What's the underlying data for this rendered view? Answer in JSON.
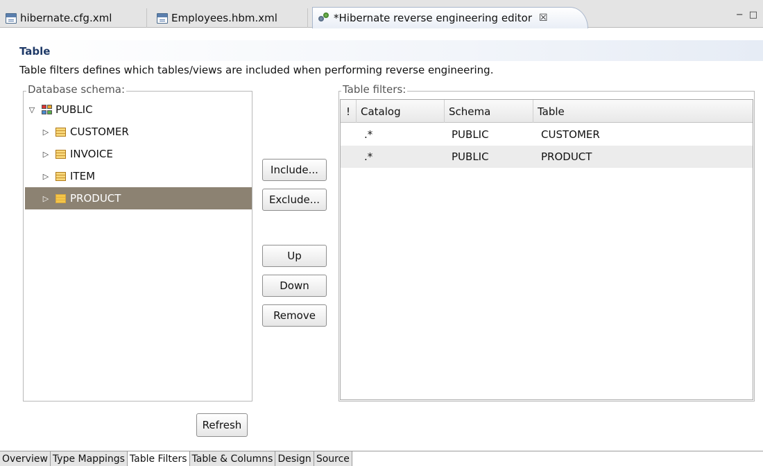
{
  "editor_tabs": [
    {
      "label": "hibernate.cfg.xml",
      "icon": "xml-file-icon"
    },
    {
      "label": "Employees.hbm.xml",
      "icon": "xml-file-icon"
    },
    {
      "label": "*Hibernate reverse engineering editor",
      "icon": "hibernate-icon",
      "close": "☒"
    }
  ],
  "window_controls": "− □",
  "section": {
    "title": "Table",
    "description": "Table filters defines which tables/views are included when performing reverse engineering."
  },
  "schema": {
    "group_label": "Database schema:",
    "root": {
      "label": "PUBLIC",
      "expanded": true
    },
    "tables": [
      {
        "label": "CUSTOMER",
        "selected": false
      },
      {
        "label": "INVOICE",
        "selected": false
      },
      {
        "label": "ITEM",
        "selected": false
      },
      {
        "label": "PRODUCT",
        "selected": true
      }
    ]
  },
  "buttons": {
    "include": "Include...",
    "exclude": "Exclude...",
    "up": "Up",
    "down": "Down",
    "remove": "Remove",
    "refresh": "Refresh"
  },
  "filters": {
    "group_label": "Table filters:",
    "columns": [
      "!",
      "Catalog",
      "Schema",
      "Table"
    ],
    "rows": [
      {
        "exclude": "",
        "catalog": ".*",
        "schema": "PUBLIC",
        "table": "CUSTOMER"
      },
      {
        "exclude": "",
        "catalog": ".*",
        "schema": "PUBLIC",
        "table": "PRODUCT"
      }
    ]
  },
  "page_tabs": [
    "Overview",
    "Type Mappings",
    "Table Filters",
    "Table & Columns",
    "Design",
    "Source"
  ],
  "active_page_tab": "Table Filters",
  "colors": {
    "selection": "#8c8272",
    "section_title": "#1f3a68",
    "alt_row": "#ececec"
  }
}
